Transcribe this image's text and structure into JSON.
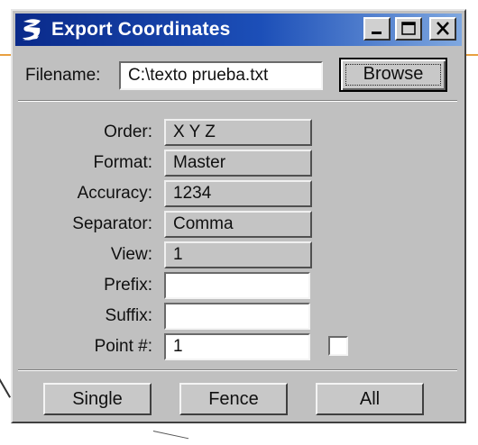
{
  "window": {
    "title": "Export Coordinates",
    "title_icon": "microstation-logo-icon",
    "controls": [
      "minimize-icon",
      "maximize-icon",
      "close-icon"
    ]
  },
  "file": {
    "label": "Filename:",
    "value": "C:\\texto prueba.txt",
    "browse_label": "Browse"
  },
  "settings": {
    "order": {
      "label": "Order:",
      "value": "X Y Z"
    },
    "format": {
      "label": "Format:",
      "value": "Master"
    },
    "accuracy": {
      "label": "Accuracy:",
      "value": "1234"
    },
    "separator": {
      "label": "Separator:",
      "value": "Comma"
    },
    "view": {
      "label": "View:",
      "value": "1"
    },
    "prefix": {
      "label": "Prefix:",
      "value": ""
    },
    "suffix": {
      "label": "Suffix:",
      "value": ""
    },
    "point": {
      "label": "Point #:",
      "value": "1",
      "checked": false
    }
  },
  "actions": {
    "single": "Single",
    "fence": "Fence",
    "all": "All"
  },
  "colors": {
    "titlebar_start": "#0a2a8a",
    "titlebar_end": "#7fa8e0",
    "face": "#c0c0c0"
  }
}
